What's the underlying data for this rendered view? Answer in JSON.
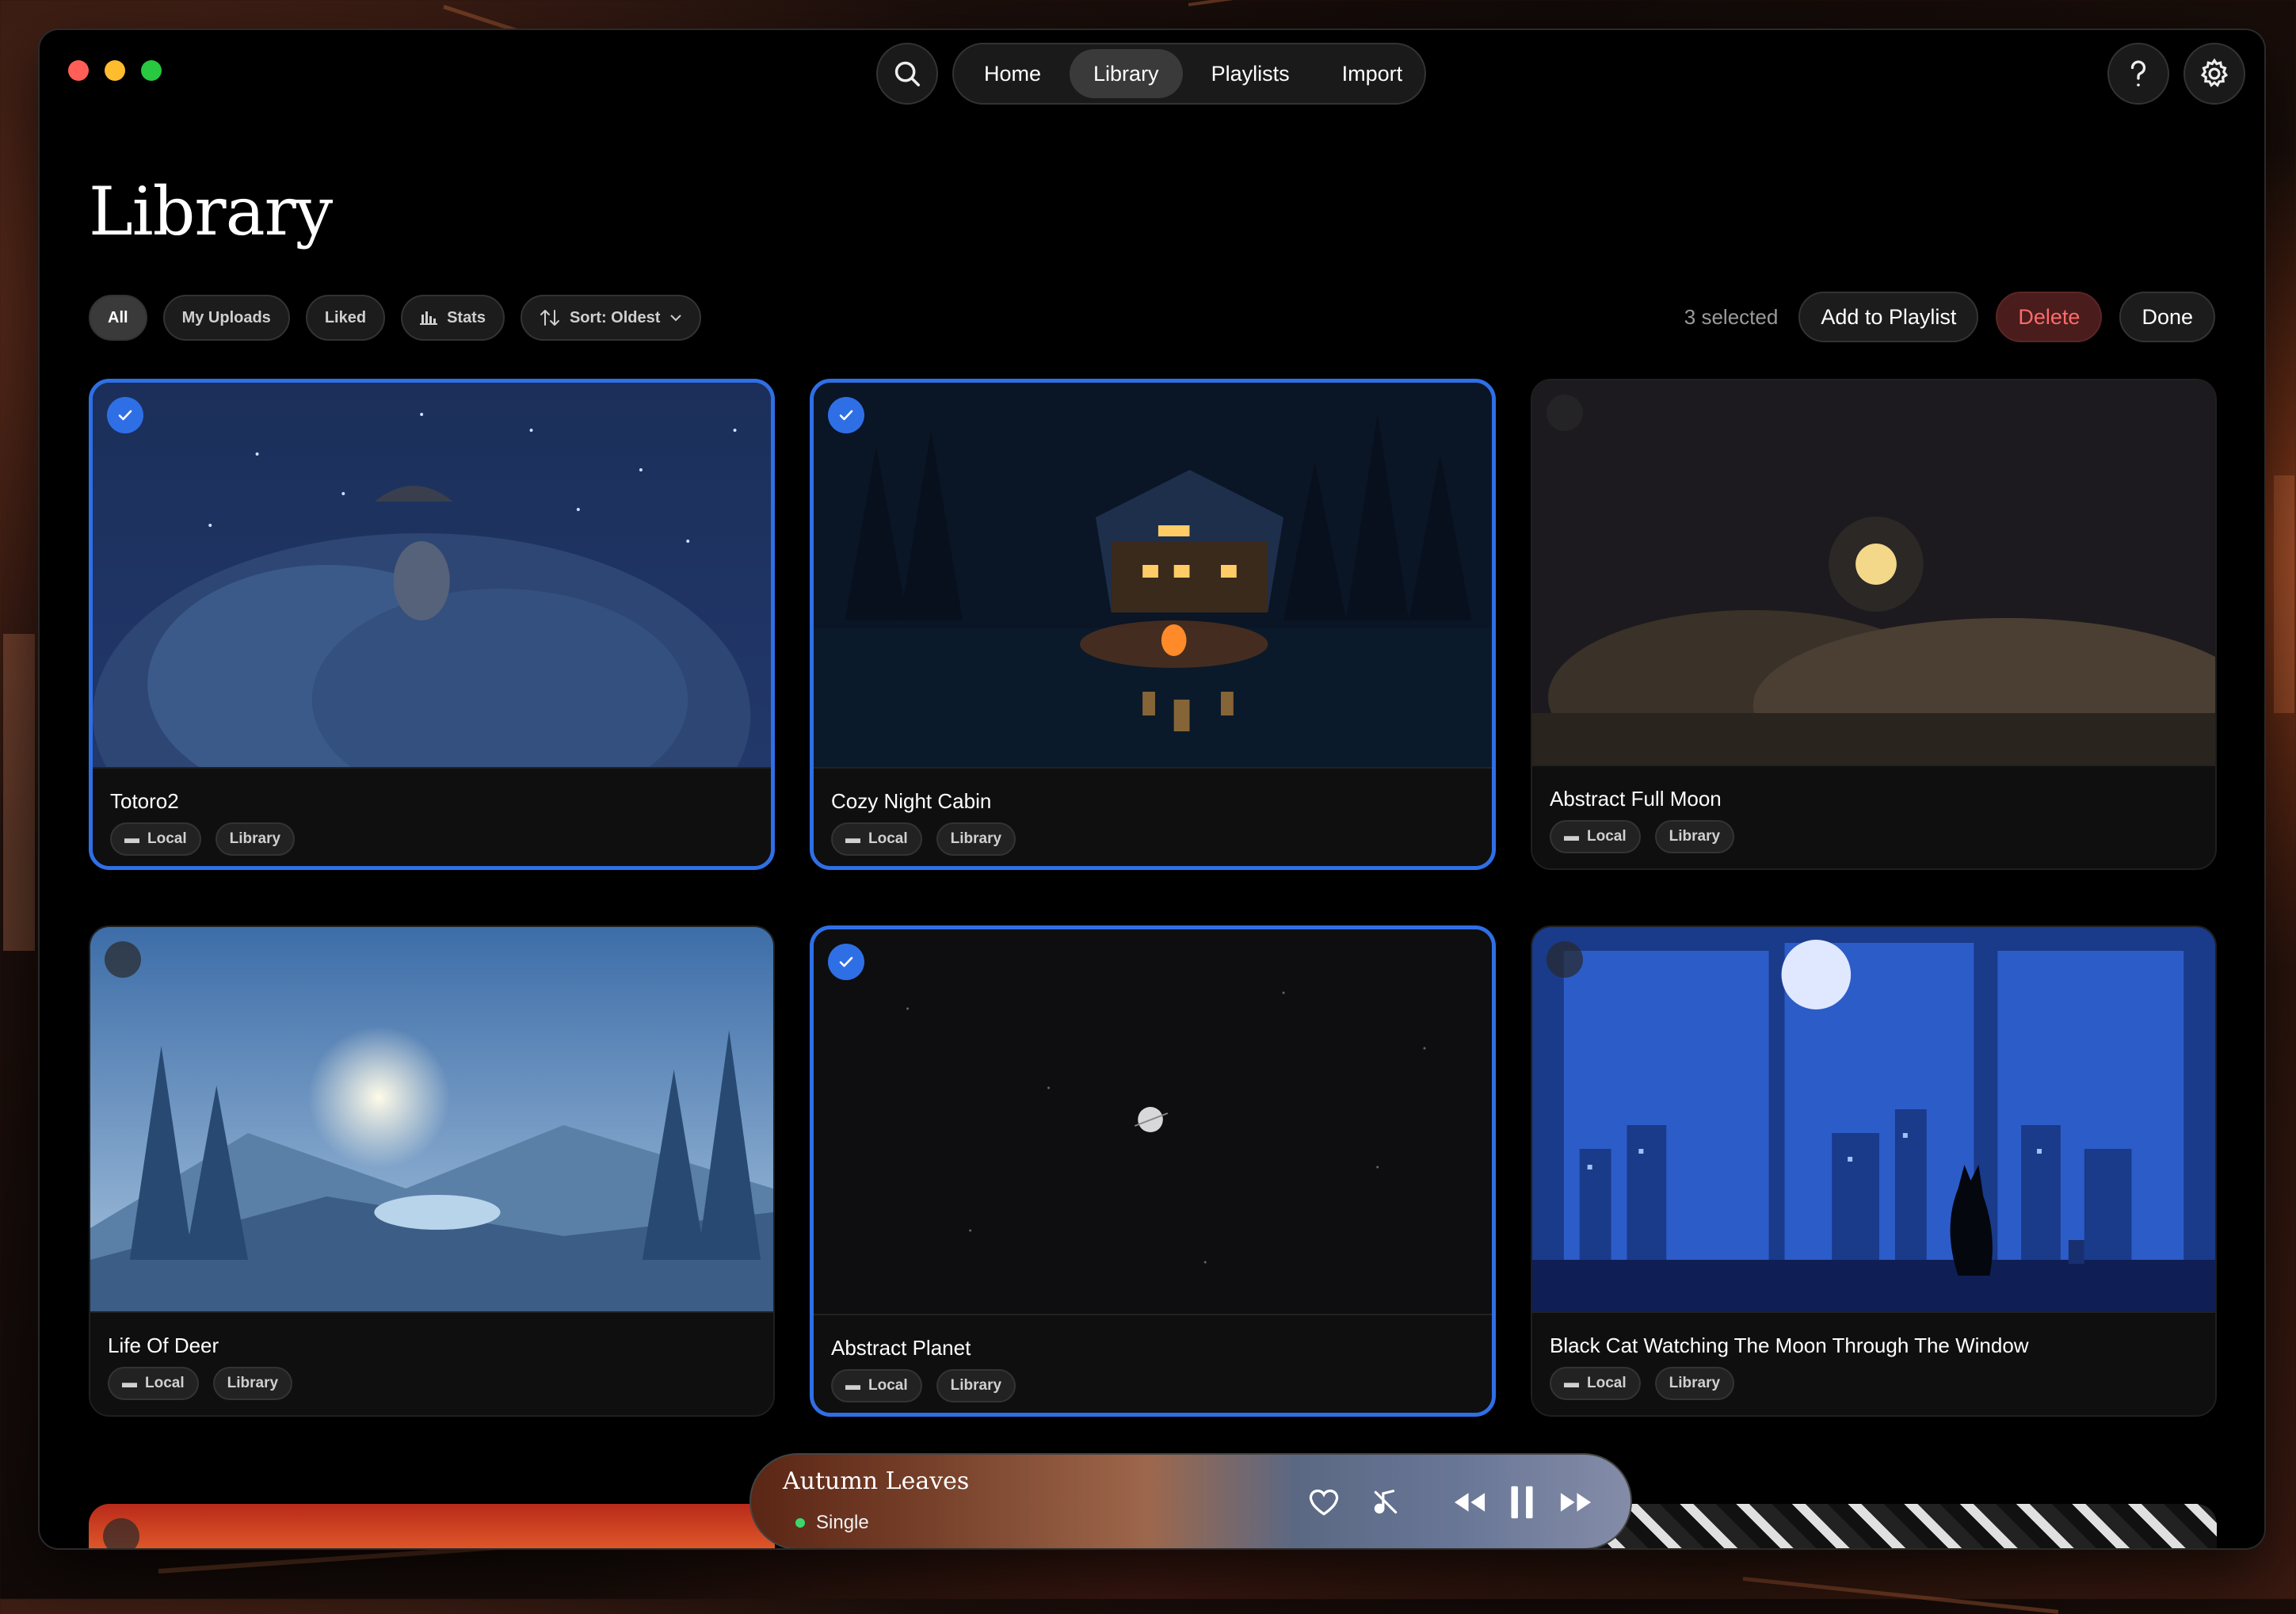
{
  "window": {
    "controls": [
      "close",
      "minimize",
      "zoom"
    ]
  },
  "nav": {
    "tabs": [
      {
        "label": "Home"
      },
      {
        "label": "Library",
        "active": true
      },
      {
        "label": "Playlists"
      },
      {
        "label": "Import"
      }
    ],
    "search_icon": "search-icon",
    "help_icon": "help-icon",
    "settings_icon": "gear-icon"
  },
  "page": {
    "title": "Library"
  },
  "filters": {
    "all": "All",
    "my_uploads": "My Uploads",
    "liked": "Liked",
    "stats": "Stats",
    "sort": "Sort: Oldest"
  },
  "selection": {
    "count_label": "3 selected",
    "add_to_playlist": "Add to Playlist",
    "delete": "Delete",
    "done": "Done"
  },
  "cards": [
    {
      "title": "Totoro2",
      "tags": [
        "Local",
        "Library"
      ],
      "selected": true
    },
    {
      "title": "Cozy Night Cabin",
      "tags": [
        "Local",
        "Library"
      ],
      "selected": true
    },
    {
      "title": "Abstract Full Moon",
      "tags": [
        "Local",
        "Library"
      ],
      "selected": false
    },
    {
      "title": "Life Of Deer",
      "tags": [
        "Local",
        "Library"
      ],
      "selected": false
    },
    {
      "title": "Abstract Planet",
      "tags": [
        "Local",
        "Library"
      ],
      "selected": true
    },
    {
      "title": "Black Cat Watching The Moon Through The Window",
      "tags": [
        "Local",
        "Library"
      ],
      "selected": false
    }
  ],
  "player": {
    "title": "Autumn Leaves",
    "subtitle": "Single",
    "state": "playing"
  },
  "colors": {
    "accent": "#2f6fe6",
    "delete": "#ff6b6b",
    "status_dot": "#3dd66a"
  }
}
